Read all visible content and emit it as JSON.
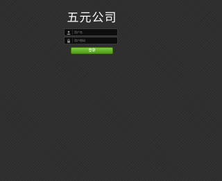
{
  "page": {
    "title": "五元公司"
  },
  "login_form": {
    "username": {
      "icon": "user-icon",
      "placeholder": "用户名",
      "value": ""
    },
    "password": {
      "icon": "lock-icon",
      "placeholder": "用户密码",
      "value": ""
    },
    "submit_label": "登录"
  },
  "colors": {
    "background": "#2f2f2f",
    "field_background": "#0d0d0d",
    "button_green": "#6bb52b",
    "title_text": "#ffffff"
  }
}
